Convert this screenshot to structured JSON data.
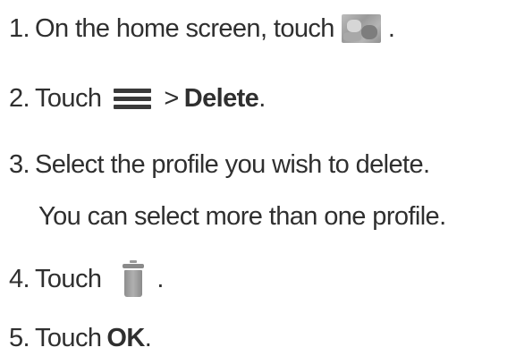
{
  "steps": [
    {
      "number": "1.",
      "text_before": "On the home screen, touch",
      "icon": "home-screen-image-icon",
      "text_after": "."
    },
    {
      "number": "2.",
      "text_before": "Touch",
      "icon": "menu-icon",
      "separator": ">",
      "bold": "Delete",
      "text_after": "."
    },
    {
      "number": "3.",
      "text_before": "Select the profile you wish to delete.",
      "note": "You can select more than one profile."
    },
    {
      "number": "4.",
      "text_before": "Touch",
      "icon": "trash-icon",
      "text_after": "."
    },
    {
      "number": "5.",
      "text_before": "Touch",
      "bold": "OK",
      "text_after": "."
    }
  ]
}
